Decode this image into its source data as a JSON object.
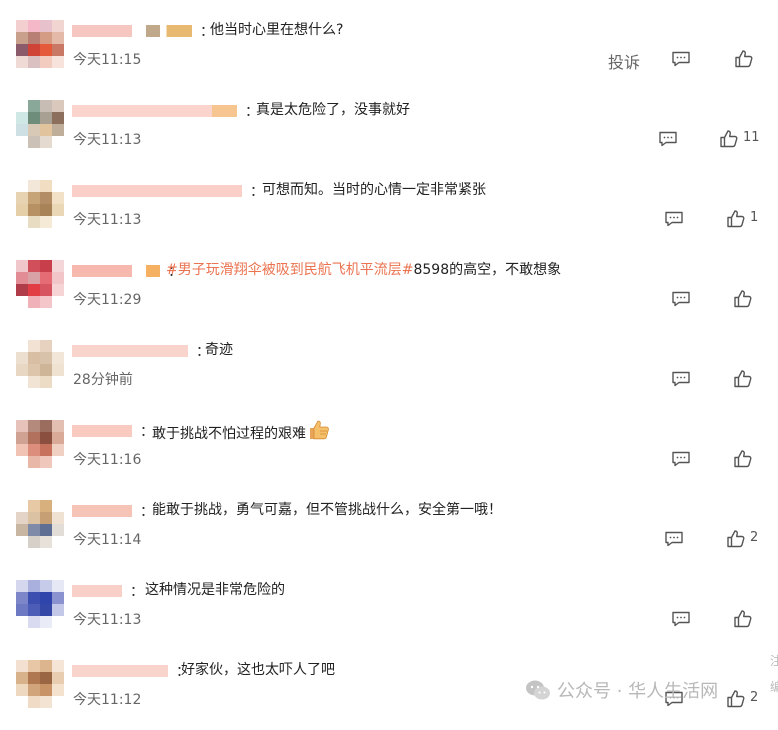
{
  "comments": [
    {
      "text": "他当时心里在想什么?",
      "time": "今天11:15",
      "report": "投诉",
      "likes": ""
    },
    {
      "text": "真是太危险了，没事就好",
      "time": "今天11:13",
      "likes": "11"
    },
    {
      "text": "可想而知。当时的心情一定非常紧张",
      "time": "今天11:13",
      "likes": "1"
    },
    {
      "hashtag": "#男子玩滑翔伞被吸到民航飞机平流层#",
      "text": "8598的高空，不敢想象",
      "time": "今天11:29",
      "likes": ""
    },
    {
      "text": "奇迹",
      "time": "28分钟前",
      "likes": ""
    },
    {
      "text": "敢于挑战不怕过程的艰难",
      "time": "今天11:16",
      "likes": "",
      "emoji": "thumbs-up-emoji"
    },
    {
      "text": "能敢于挑战，勇气可嘉，但不管挑战什么，安全第一哦！",
      "time": "今天11:14",
      "likes": "2"
    },
    {
      "text": "这种情况是非常危险的",
      "time": "今天11:13",
      "likes": ""
    },
    {
      "text": "好家伙，这也太吓人了吧",
      "time": "今天11:12",
      "likes": "2"
    }
  ],
  "colon": "：",
  "watermark": {
    "text": "公众号 · 华人生活网",
    "icon": "wechat-icon"
  },
  "edge_marks": [
    "注",
    "编"
  ],
  "colors": {
    "hashtag": "#eb7350",
    "time": "#666666",
    "icon": "#555555"
  }
}
